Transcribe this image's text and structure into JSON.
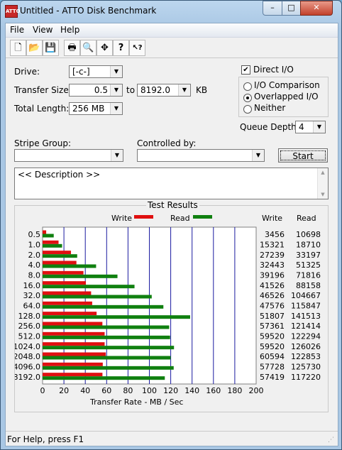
{
  "window": {
    "title": "Untitled - ATTO Disk Benchmark",
    "icon_label": "ATTO"
  },
  "title_buttons": {
    "minimize": "–",
    "maximize": "□",
    "close": "✕"
  },
  "menu": [
    "File",
    "View",
    "Help"
  ],
  "toolbar_icons": [
    {
      "name": "new-icon",
      "glyph": "🗋"
    },
    {
      "name": "open-icon",
      "glyph": "📂"
    },
    {
      "name": "save-icon",
      "glyph": "💾"
    },
    {
      "name": "print-icon",
      "glyph": "🖶"
    },
    {
      "name": "print-preview-icon",
      "glyph": "🔍"
    },
    {
      "name": "move-icon",
      "glyph": "✥"
    },
    {
      "name": "help-icon",
      "glyph": "?"
    },
    {
      "name": "context-help-icon",
      "glyph": "↖?"
    }
  ],
  "form": {
    "drive_label": "Drive:",
    "drive_value": "[-c-]",
    "transfer_size_label": "Transfer Size:",
    "transfer_min": "0.5",
    "to_label": "to",
    "transfer_max": "8192.0",
    "kb_label": "KB",
    "total_length_label": "Total Length:",
    "total_length_value": "256 MB",
    "direct_io_label": "Direct I/O",
    "direct_io_checked": true,
    "mode_options": [
      "I/O Comparison",
      "Overlapped I/O",
      "Neither"
    ],
    "mode_selected": "Overlapped I/O",
    "queue_depth_label": "Queue Depth:",
    "queue_depth_value": "4",
    "stripe_group_label": "Stripe Group:",
    "stripe_group_value": "",
    "controlled_by_label": "Controlled by:",
    "controlled_by_value": "",
    "start_label": "Start",
    "description": "<< Description >>"
  },
  "results": {
    "group_title": "Test Results",
    "write_legend": "Write",
    "read_legend": "Read",
    "write_col": "Write",
    "read_col": "Read"
  },
  "colors": {
    "write": "#e01010",
    "read": "#108010",
    "grid": "#1a1aa0"
  },
  "chart_data": {
    "type": "bar",
    "orientation": "horizontal",
    "categories": [
      "0.5",
      "1.0",
      "2.0",
      "4.0",
      "8.0",
      "16.0",
      "32.0",
      "64.0",
      "128.0",
      "256.0",
      "512.0",
      "1024.0",
      "2048.0",
      "4096.0",
      "8192.0"
    ],
    "series": [
      {
        "name": "Write",
        "values": [
          3456,
          15321,
          27239,
          32443,
          39196,
          41526,
          46526,
          47576,
          51807,
          57361,
          59520,
          59520,
          60594,
          57728,
          57419
        ]
      },
      {
        "name": "Read",
        "values": [
          10698,
          18710,
          33197,
          51325,
          71816,
          88158,
          104667,
          115847,
          141513,
          121414,
          122294,
          126026,
          122853,
          125730,
          117220
        ]
      }
    ],
    "value_unit": "KB/s",
    "xlabel": "Transfer Rate - MB / Sec",
    "xlim": [
      0,
      200
    ],
    "xticks": [
      "0",
      "20",
      "40",
      "60",
      "80",
      "100",
      "120",
      "140",
      "160",
      "180",
      "200"
    ],
    "grid": true
  },
  "status": {
    "text": "For Help, press F1"
  }
}
